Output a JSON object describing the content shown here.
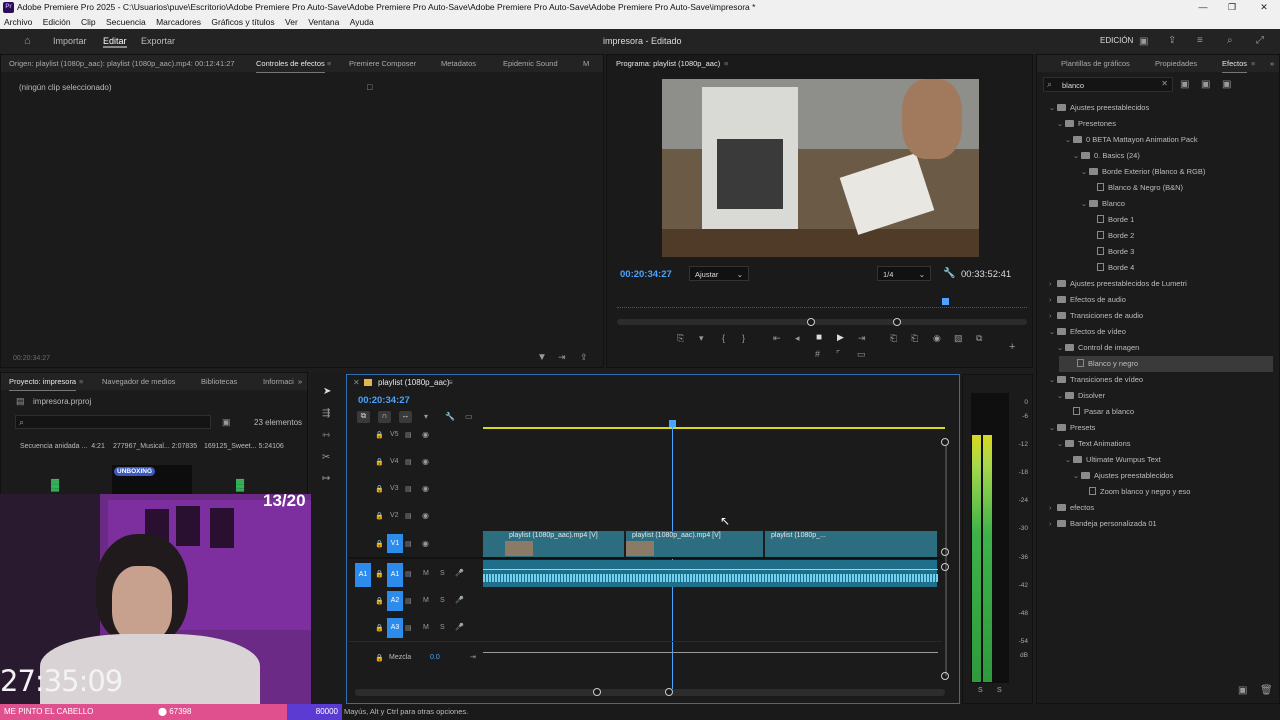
{
  "window": {
    "title": "Adobe Premiere Pro 2025 - C:\\Usuarios\\puve\\Escritorio\\Adobe Premiere Pro Auto-Save\\Adobe Premiere Pro Auto-Save\\Adobe Premiere Pro Auto-Save\\Adobe Premiere Pro Auto-Save\\impresora *",
    "app_icon": "Pr"
  },
  "menu": [
    "Archivo",
    "Edición",
    "Clip",
    "Secuencia",
    "Marcadores",
    "Gráficos y títulos",
    "Ver",
    "Ventana",
    "Ayuda"
  ],
  "workbar": {
    "import": "Importar",
    "edit": "Editar",
    "export": "Exportar",
    "project_title": "impresora - Editado",
    "workspace": "EDICIÓN"
  },
  "source_panel": {
    "tabs": [
      "Origen: playlist (1080p_aac): playlist (1080p_aac).mp4: 00:12:41:27",
      "Controles de efectos",
      "Premiere Composer",
      "Metadatos",
      "Epidemic Sound",
      "M"
    ],
    "no_clip": "(ningún clip seleccionado)",
    "timecode": "00:20:34:27"
  },
  "program": {
    "title": "Programa: playlist (1080p_aac)",
    "timecode": "00:20:34:27",
    "fit": "Ajustar",
    "res": "1/4",
    "duration": "00:33:52:41"
  },
  "project": {
    "tabs": [
      "Proyecto: impresora",
      "Navegador de medios",
      "Bibliotecas",
      "Informaci"
    ],
    "file": "impresora.prproj",
    "count": "23 elementos",
    "items": [
      {
        "name": "Secuencia anidada ...",
        "dur": "4:21"
      },
      {
        "name": "277967_Musical...",
        "dur": "2:07835"
      },
      {
        "name": "169125_Sweet...",
        "dur": "5:24106"
      }
    ],
    "badge": "UNBOXING"
  },
  "webcam": {
    "counter": "13/20",
    "clock": "27:35:09"
  },
  "overlay": {
    "left": "ME PINTO EL CABELLO",
    "mid": "67398",
    "right": "80000"
  },
  "timeline": {
    "tab": "playlist (1080p_aac)",
    "timecode": "00:20:34:27",
    "video_tracks": [
      "V5",
      "V4",
      "V3",
      "V2",
      "V1"
    ],
    "audio_tracks": [
      "A1",
      "A2",
      "A3"
    ],
    "mix_label": "Mezcla",
    "mix_value": "0.0",
    "clips": [
      "playlist (1080p_aac).mp4 [V]",
      "playlist (1080p_aac).mp4 [V]",
      "playlist (1080p_..."
    ]
  },
  "meter": {
    "labels": [
      "0",
      "-6",
      "-12",
      "-18",
      "-24",
      "-30",
      "-36",
      "-42",
      "-48",
      "-54",
      "dB"
    ],
    "sub": [
      "S",
      "S"
    ]
  },
  "effects": {
    "tabs": [
      "Plantillas de gráficos",
      "Propiedades",
      "Efectos"
    ],
    "search": "blanco",
    "rows": [
      {
        "label": "Ajustes preestablecidos",
        "lvl": 0,
        "open": true,
        "kind": "folder"
      },
      {
        "label": "Presetones",
        "lvl": 1,
        "open": true,
        "kind": "folder"
      },
      {
        "label": "0 BETA Mattayon Animation Pack",
        "lvl": 2,
        "open": true,
        "kind": "folder"
      },
      {
        "label": "0. Basics (24)",
        "lvl": 3,
        "open": true,
        "kind": "folder"
      },
      {
        "label": "Borde Exterior (Blanco & RGB)",
        "lvl": 4,
        "open": true,
        "kind": "folder"
      },
      {
        "label": "Blanco & Negro (B&N)",
        "lvl": 5,
        "kind": "preset"
      },
      {
        "label": "Blanco",
        "lvl": 4,
        "open": true,
        "kind": "folder"
      },
      {
        "label": "Borde 1",
        "lvl": 5,
        "kind": "preset"
      },
      {
        "label": "Borde 2",
        "lvl": 5,
        "kind": "preset"
      },
      {
        "label": "Borde 3",
        "lvl": 5,
        "kind": "preset"
      },
      {
        "label": "Borde 4",
        "lvl": 5,
        "kind": "preset"
      },
      {
        "label": "Ajustes preestablecidos de Lumetri",
        "lvl": 0,
        "open": false,
        "kind": "folder"
      },
      {
        "label": "Efectos de audio",
        "lvl": 0,
        "open": false,
        "kind": "folder"
      },
      {
        "label": "Transiciones de audio",
        "lvl": 0,
        "open": false,
        "kind": "folder"
      },
      {
        "label": "Efectos de vídeo",
        "lvl": 0,
        "open": true,
        "kind": "folder"
      },
      {
        "label": "Control de imagen",
        "lvl": 1,
        "open": true,
        "kind": "folder"
      },
      {
        "label": "Blanco y negro",
        "lvl": 2,
        "kind": "preset",
        "selected": true
      },
      {
        "label": "Transiciones de vídeo",
        "lvl": 0,
        "open": true,
        "kind": "folder"
      },
      {
        "label": "Disolver",
        "lvl": 1,
        "open": true,
        "kind": "folder"
      },
      {
        "label": "Pasar a blanco",
        "lvl": 2,
        "kind": "preset"
      },
      {
        "label": "Presets",
        "lvl": 0,
        "open": true,
        "kind": "folder"
      },
      {
        "label": "Text Animations",
        "lvl": 1,
        "open": true,
        "kind": "folder"
      },
      {
        "label": "Ultimate Wumpus Text",
        "lvl": 2,
        "open": true,
        "kind": "folder"
      },
      {
        "label": "Ajustes preestablecidos",
        "lvl": 3,
        "open": true,
        "kind": "folder"
      },
      {
        "label": "Zoom blanco y negro y eso",
        "lvl": 4,
        "kind": "preset"
      },
      {
        "label": "efectos",
        "lvl": 0,
        "open": false,
        "kind": "folder"
      },
      {
        "label": "Bandeja personalizada 01",
        "lvl": 0,
        "open": false,
        "kind": "folder"
      }
    ]
  },
  "status": "Mayús, Alt y Ctrl para otras opciones.",
  "colors": {
    "accent": "#2d8ceb",
    "timecode": "#4aa3ff",
    "clip_video": "#2d6d80",
    "clip_audio": "#1f6e8a",
    "overlay_pink": "#e0508f",
    "overlay_purple": "#5b3bd1"
  }
}
